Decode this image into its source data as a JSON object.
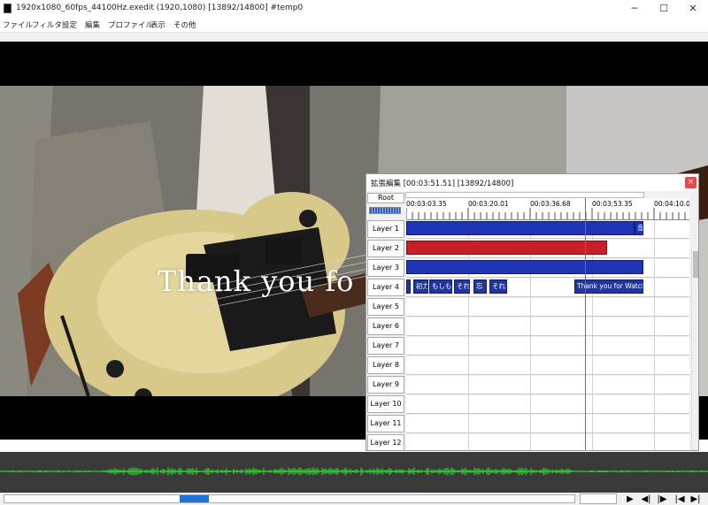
{
  "window": {
    "title": "1920x1080_60fps_44100Hz.exedit (1920,1080)  [13892/14800]  #temp0",
    "minimize": "─",
    "maximize": "☐",
    "close": "✕"
  },
  "menu": [
    "ファイル",
    "フィルタ",
    "設定",
    "編集",
    "プロファイル",
    "表示",
    "その他"
  ],
  "preview": {
    "caption": "Thank you fo"
  },
  "timeline": {
    "title": "拡張編集 [00:03:51.51] [13892/14800]",
    "close": "×",
    "root": "Root",
    "ticks": [
      "00:03:03.35",
      "00:03:20.01",
      "00:03:36.68",
      "00:03:53.35",
      "00:04:10.0"
    ],
    "layers": [
      "Layer 1",
      "Layer 2",
      "Layer 3",
      "Layer 4",
      "Layer 5",
      "Layer 6",
      "Layer 7",
      "Layer 8",
      "Layer 9",
      "Layer 10",
      "Layer 11",
      "Layer 12"
    ],
    "layer1_end_label": "音",
    "layer4_clips": [
      "",
      "初力",
      "もしもこ",
      "それ",
      "忘",
      "それが",
      "Thank you for Watch"
    ]
  },
  "playback": {
    "play": "▶",
    "prev_frame": "◀|",
    "next_frame": "|▶",
    "to_start": "|◀",
    "to_end": "▶|"
  },
  "colors": {
    "accent_blue": "#1f34b5",
    "clip_red": "#c8202a",
    "waveform_green": "#2ee82e",
    "cursor_red": "#e04040"
  }
}
